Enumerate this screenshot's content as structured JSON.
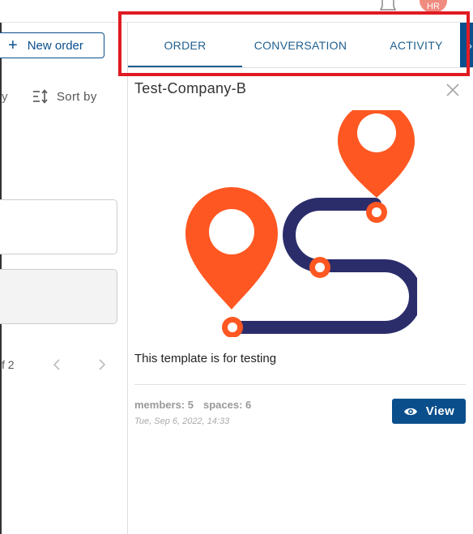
{
  "header": {
    "avatar_initials": "HR"
  },
  "left_panel": {
    "new_order_label": "New order",
    "sort_fragment": "y",
    "sort_label": "Sort by",
    "pagination_fragment": "f 2"
  },
  "tabs": [
    {
      "label": "ORDER",
      "active": true
    },
    {
      "label": "CONVERSATION",
      "active": false
    },
    {
      "label": "ACTIVITY",
      "active": false
    }
  ],
  "tab_scroll_glyph": "›",
  "detail": {
    "title": "Test-Company-B",
    "description": "This template is for testing",
    "members_text": "members: 5",
    "spaces_text": "spaces: 6",
    "date": "Tue, Sep 6, 2022, 14:33",
    "view_label": "View"
  },
  "colors": {
    "accent": "#0a4f8c",
    "highlight": "#e01b22",
    "pin": "#ff5722",
    "route": "#2b2d6b"
  },
  "icons": [
    "bell-icon",
    "plus-icon",
    "sort-icon",
    "chevron-left-icon",
    "chevron-right-icon",
    "close-icon",
    "eye-icon",
    "chevron-right-icon"
  ]
}
